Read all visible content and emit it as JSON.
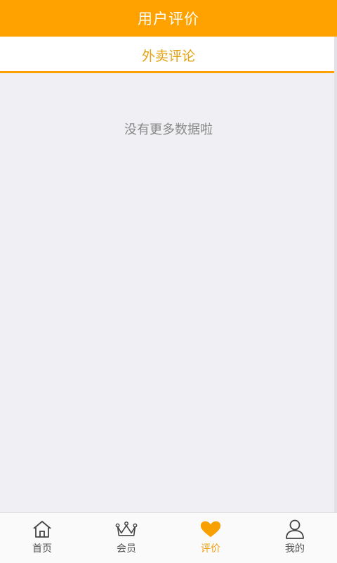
{
  "header": {
    "title": "用户评价"
  },
  "tabs": [
    {
      "label": "外卖评论",
      "active": true
    }
  ],
  "content": {
    "empty_message": "没有更多数据啦"
  },
  "bottom_nav": {
    "items": [
      {
        "label": "首页",
        "icon": "home-icon",
        "active": false
      },
      {
        "label": "会员",
        "icon": "crown-icon",
        "active": false
      },
      {
        "label": "评价",
        "icon": "heart-icon",
        "active": true
      },
      {
        "label": "我的",
        "icon": "user-icon",
        "active": false
      }
    ]
  },
  "colors": {
    "accent": "#ffa200",
    "background": "#efeff4",
    "active_label": "#f0a010"
  }
}
